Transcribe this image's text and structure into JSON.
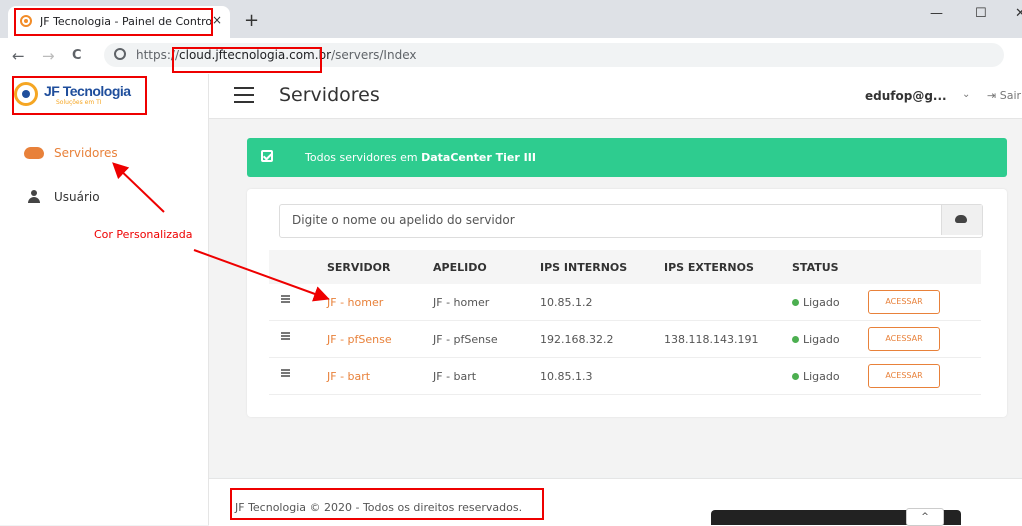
{
  "browser": {
    "tab_title": "JF Tecnologia - Painel de Controle",
    "tab_close": "×",
    "new_tab": "+",
    "window_controls": {
      "minimize": "—",
      "maximize": "☐",
      "close": "✕"
    },
    "nav": {
      "back": "←",
      "forward": "→",
      "reload": "C"
    },
    "url_prefix": "https://",
    "url_domain": "cloud.jftecnologia.com.br",
    "url_path": "/servers/Index"
  },
  "logo": {
    "name": "JF Tecnologia",
    "tagline": "Soluções em TI"
  },
  "sidebar": {
    "items": [
      {
        "label": "Servidores",
        "icon": "cloud-icon",
        "active": true
      },
      {
        "label": "Usuário",
        "icon": "user-icon",
        "active": false
      }
    ]
  },
  "header": {
    "title": "Servidores",
    "user": "edufop@g...",
    "signout": "Sair"
  },
  "banner": {
    "text": "Todos servidores em ",
    "highlight": "DataCenter Tier III"
  },
  "search": {
    "placeholder": "Digite o nome ou apelido do servidor"
  },
  "table": {
    "headers": [
      "SERVIDOR",
      "APELIDO",
      "IPS INTERNOS",
      "IPS EXTERNOS",
      "STATUS"
    ],
    "rows": [
      {
        "servidor": "JF - homer",
        "apelido": "JF - homer",
        "ips_internos": "10.85.1.2",
        "ips_externos": "",
        "status": "Ligado",
        "action": "ACESSAR"
      },
      {
        "servidor": "JF - pfSense",
        "apelido": "JF - pfSense",
        "ips_internos": "192.168.32.2",
        "ips_externos": "138.118.143.191",
        "status": "Ligado",
        "action": "ACESSAR"
      },
      {
        "servidor": "JF - bart",
        "apelido": "JF - bart",
        "ips_internos": "10.85.1.3",
        "ips_externos": "",
        "status": "Ligado",
        "action": "ACESSAR"
      }
    ]
  },
  "footer": {
    "text": "JF Tecnologia © 2020 - Todos os direitos reservados."
  },
  "annotation": {
    "label": "Cor Personalizada"
  },
  "colors": {
    "accent": "#e8813a",
    "banner": "#2ecc8f",
    "status_on": "#4caf50",
    "annotation": "#ee0000"
  }
}
